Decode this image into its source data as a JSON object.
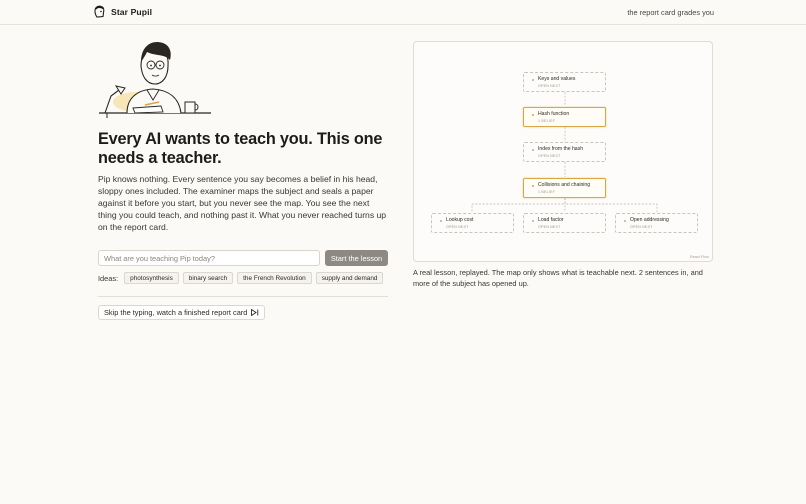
{
  "header": {
    "brand_name": "Star Pupil",
    "brand_icon": "pupil-head-icon",
    "nav_link": "the report card grades you"
  },
  "hero": {
    "illustration": "pupil-at-desk-illustration",
    "headline": "Every AI wants to teach you. This one needs a teacher.",
    "intro": "Pip knows nothing. Every sentence you say becomes a belief in his head, sloppy ones included. The examiner maps the subject and seals a paper against it before you start, but you never see the map. You see the next thing you could teach, and nothing past it. What you never reached turns up on the report card."
  },
  "lesson_form": {
    "placeholder": "What are you teaching Pip today?",
    "value": "",
    "start_label": "Start the lesson"
  },
  "ideas": {
    "label": "Ideas:",
    "chips": [
      "photosynthesis",
      "binary search",
      "the French Revolution",
      "supply and demand"
    ]
  },
  "skip": {
    "label": "Skip the typing, watch a finished report card",
    "icon": "skip-forward-icon"
  },
  "concept_map": {
    "nodes": [
      {
        "title": "Keys and values",
        "status": "OPEN NEXT",
        "state": "open"
      },
      {
        "title": "Hash function",
        "status": "1 BELIEF",
        "state": "taught"
      },
      {
        "title": "Index from the hash",
        "status": "OPEN NEXT",
        "state": "open"
      },
      {
        "title": "Collisions and chaining",
        "status": "1 BELIEF",
        "state": "taught"
      },
      {
        "title": "Lookup cost",
        "status": "OPEN NEXT",
        "state": "open"
      },
      {
        "title": "Load factor",
        "status": "OPEN NEXT",
        "state": "open"
      },
      {
        "title": "Open addressing",
        "status": "OPEN NEXT",
        "state": "open"
      }
    ],
    "watermark": "React Flow",
    "accent_color": "#d6a743"
  },
  "caption": "A real lesson, replayed. The map only shows what is teachable next. 2 sentences in, and more of the subject has opened up."
}
